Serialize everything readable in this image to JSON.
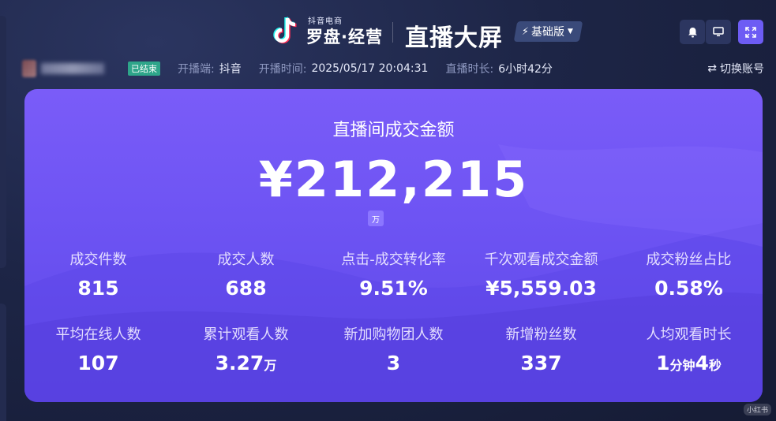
{
  "header": {
    "brand_sub": "抖音电商",
    "brand_main": "罗盘·经营",
    "screen_title": "直播大屏",
    "edition_label": "基础版"
  },
  "status": {
    "ended_badge": "已结束",
    "platform_label": "开播端:",
    "platform_value": "抖音",
    "start_label": "开播时间:",
    "start_value": "2025/05/17 20:04:31",
    "duration_label": "直播时长:",
    "duration_value": "6小时42分",
    "switch_account": "切换账号"
  },
  "gmv": {
    "title": "直播间成交金额",
    "value": "¥212,215",
    "unit": "万"
  },
  "metrics": [
    {
      "label": "成交件数",
      "value": "815"
    },
    {
      "label": "成交人数",
      "value": "688"
    },
    {
      "label": "点击-成交转化率",
      "value": "9.51%"
    },
    {
      "label": "千次观看成交金额",
      "value": "¥5,559.03"
    },
    {
      "label": "成交粉丝占比",
      "value": "0.58%"
    },
    {
      "label": "平均在线人数",
      "value": "107"
    },
    {
      "label": "累计观看人数",
      "value": "3.27",
      "unit": "万"
    },
    {
      "label": "新加购物团人数",
      "value": "3"
    },
    {
      "label": "新增粉丝数",
      "value": "337"
    },
    {
      "label": "人均观看时长",
      "v1": "1",
      "u1": "分钟",
      "v2": "4",
      "u2": "秒"
    }
  ],
  "watermark": "小红书",
  "colors": {
    "accent": "#6d5cf4",
    "card_top": "#7a5cf8",
    "card_bottom": "#5d47e4",
    "ended_badge": "#2ea58a"
  },
  "icons": [
    "douyin-note-icon",
    "bolt-icon",
    "caret-down-icon",
    "bell-icon",
    "monitor-icon",
    "fullscreen-icon",
    "swap-icon"
  ]
}
